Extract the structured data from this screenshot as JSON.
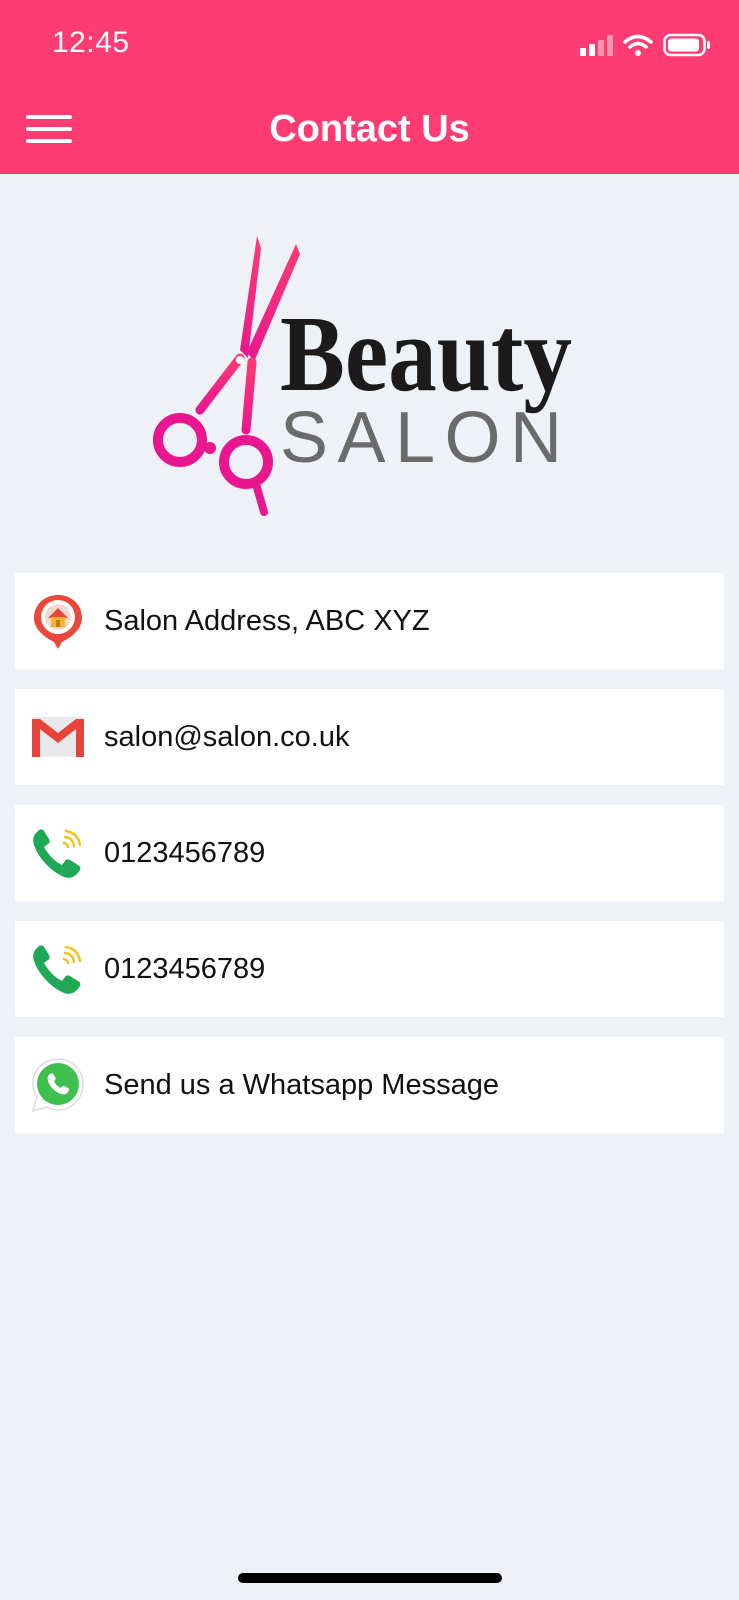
{
  "status_bar": {
    "time": "12:45"
  },
  "header": {
    "title": "Contact Us",
    "menu_icon": "hamburger-menu-icon",
    "background_color": "#ff3b74"
  },
  "logo": {
    "word1": "Beauty",
    "word2": "SALON",
    "accent_color": "#ff2e8c"
  },
  "contacts": [
    {
      "icon": "location-pin-icon",
      "label": "Salon Address, ABC XYZ"
    },
    {
      "icon": "gmail-icon",
      "label": "salon@salon.co.uk"
    },
    {
      "icon": "phone-call-icon",
      "label": "0123456789"
    },
    {
      "icon": "phone-call-icon",
      "label": "0123456789"
    },
    {
      "icon": "whatsapp-icon",
      "label": "Send us a Whatsapp Message"
    }
  ]
}
